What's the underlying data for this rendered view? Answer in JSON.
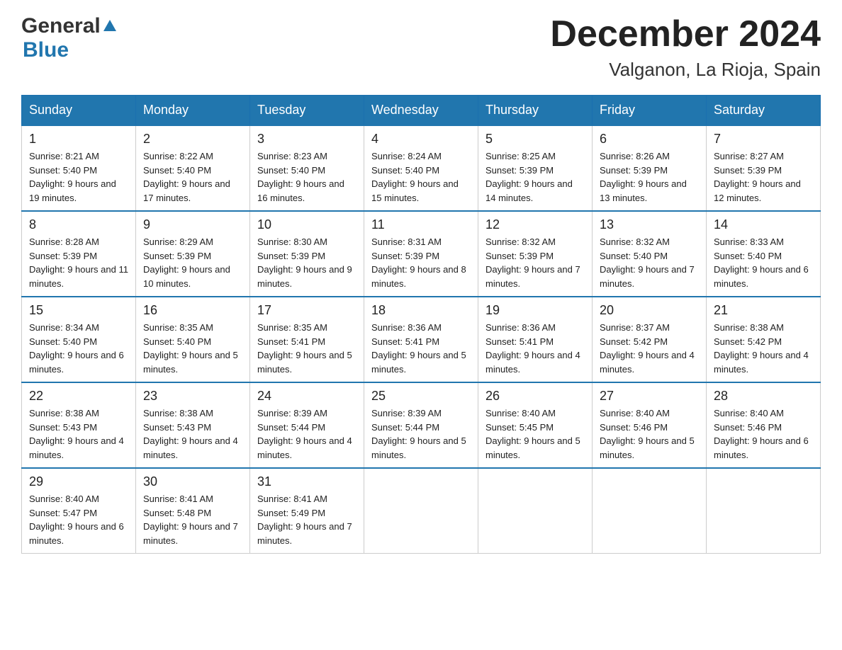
{
  "header": {
    "logo_general": "General",
    "logo_blue": "Blue",
    "month_title": "December 2024",
    "location": "Valganon, La Rioja, Spain"
  },
  "weekdays": [
    "Sunday",
    "Monday",
    "Tuesday",
    "Wednesday",
    "Thursday",
    "Friday",
    "Saturday"
  ],
  "weeks": [
    [
      {
        "day": "1",
        "sunrise": "8:21 AM",
        "sunset": "5:40 PM",
        "daylight": "9 hours and 19 minutes."
      },
      {
        "day": "2",
        "sunrise": "8:22 AM",
        "sunset": "5:40 PM",
        "daylight": "9 hours and 17 minutes."
      },
      {
        "day": "3",
        "sunrise": "8:23 AM",
        "sunset": "5:40 PM",
        "daylight": "9 hours and 16 minutes."
      },
      {
        "day": "4",
        "sunrise": "8:24 AM",
        "sunset": "5:40 PM",
        "daylight": "9 hours and 15 minutes."
      },
      {
        "day": "5",
        "sunrise": "8:25 AM",
        "sunset": "5:39 PM",
        "daylight": "9 hours and 14 minutes."
      },
      {
        "day": "6",
        "sunrise": "8:26 AM",
        "sunset": "5:39 PM",
        "daylight": "9 hours and 13 minutes."
      },
      {
        "day": "7",
        "sunrise": "8:27 AM",
        "sunset": "5:39 PM",
        "daylight": "9 hours and 12 minutes."
      }
    ],
    [
      {
        "day": "8",
        "sunrise": "8:28 AM",
        "sunset": "5:39 PM",
        "daylight": "9 hours and 11 minutes."
      },
      {
        "day": "9",
        "sunrise": "8:29 AM",
        "sunset": "5:39 PM",
        "daylight": "9 hours and 10 minutes."
      },
      {
        "day": "10",
        "sunrise": "8:30 AM",
        "sunset": "5:39 PM",
        "daylight": "9 hours and 9 minutes."
      },
      {
        "day": "11",
        "sunrise": "8:31 AM",
        "sunset": "5:39 PM",
        "daylight": "9 hours and 8 minutes."
      },
      {
        "day": "12",
        "sunrise": "8:32 AM",
        "sunset": "5:39 PM",
        "daylight": "9 hours and 7 minutes."
      },
      {
        "day": "13",
        "sunrise": "8:32 AM",
        "sunset": "5:40 PM",
        "daylight": "9 hours and 7 minutes."
      },
      {
        "day": "14",
        "sunrise": "8:33 AM",
        "sunset": "5:40 PM",
        "daylight": "9 hours and 6 minutes."
      }
    ],
    [
      {
        "day": "15",
        "sunrise": "8:34 AM",
        "sunset": "5:40 PM",
        "daylight": "9 hours and 6 minutes."
      },
      {
        "day": "16",
        "sunrise": "8:35 AM",
        "sunset": "5:40 PM",
        "daylight": "9 hours and 5 minutes."
      },
      {
        "day": "17",
        "sunrise": "8:35 AM",
        "sunset": "5:41 PM",
        "daylight": "9 hours and 5 minutes."
      },
      {
        "day": "18",
        "sunrise": "8:36 AM",
        "sunset": "5:41 PM",
        "daylight": "9 hours and 5 minutes."
      },
      {
        "day": "19",
        "sunrise": "8:36 AM",
        "sunset": "5:41 PM",
        "daylight": "9 hours and 4 minutes."
      },
      {
        "day": "20",
        "sunrise": "8:37 AM",
        "sunset": "5:42 PM",
        "daylight": "9 hours and 4 minutes."
      },
      {
        "day": "21",
        "sunrise": "8:38 AM",
        "sunset": "5:42 PM",
        "daylight": "9 hours and 4 minutes."
      }
    ],
    [
      {
        "day": "22",
        "sunrise": "8:38 AM",
        "sunset": "5:43 PM",
        "daylight": "9 hours and 4 minutes."
      },
      {
        "day": "23",
        "sunrise": "8:38 AM",
        "sunset": "5:43 PM",
        "daylight": "9 hours and 4 minutes."
      },
      {
        "day": "24",
        "sunrise": "8:39 AM",
        "sunset": "5:44 PM",
        "daylight": "9 hours and 4 minutes."
      },
      {
        "day": "25",
        "sunrise": "8:39 AM",
        "sunset": "5:44 PM",
        "daylight": "9 hours and 5 minutes."
      },
      {
        "day": "26",
        "sunrise": "8:40 AM",
        "sunset": "5:45 PM",
        "daylight": "9 hours and 5 minutes."
      },
      {
        "day": "27",
        "sunrise": "8:40 AM",
        "sunset": "5:46 PM",
        "daylight": "9 hours and 5 minutes."
      },
      {
        "day": "28",
        "sunrise": "8:40 AM",
        "sunset": "5:46 PM",
        "daylight": "9 hours and 6 minutes."
      }
    ],
    [
      {
        "day": "29",
        "sunrise": "8:40 AM",
        "sunset": "5:47 PM",
        "daylight": "9 hours and 6 minutes."
      },
      {
        "day": "30",
        "sunrise": "8:41 AM",
        "sunset": "5:48 PM",
        "daylight": "9 hours and 7 minutes."
      },
      {
        "day": "31",
        "sunrise": "8:41 AM",
        "sunset": "5:49 PM",
        "daylight": "9 hours and 7 minutes."
      },
      null,
      null,
      null,
      null
    ]
  ]
}
